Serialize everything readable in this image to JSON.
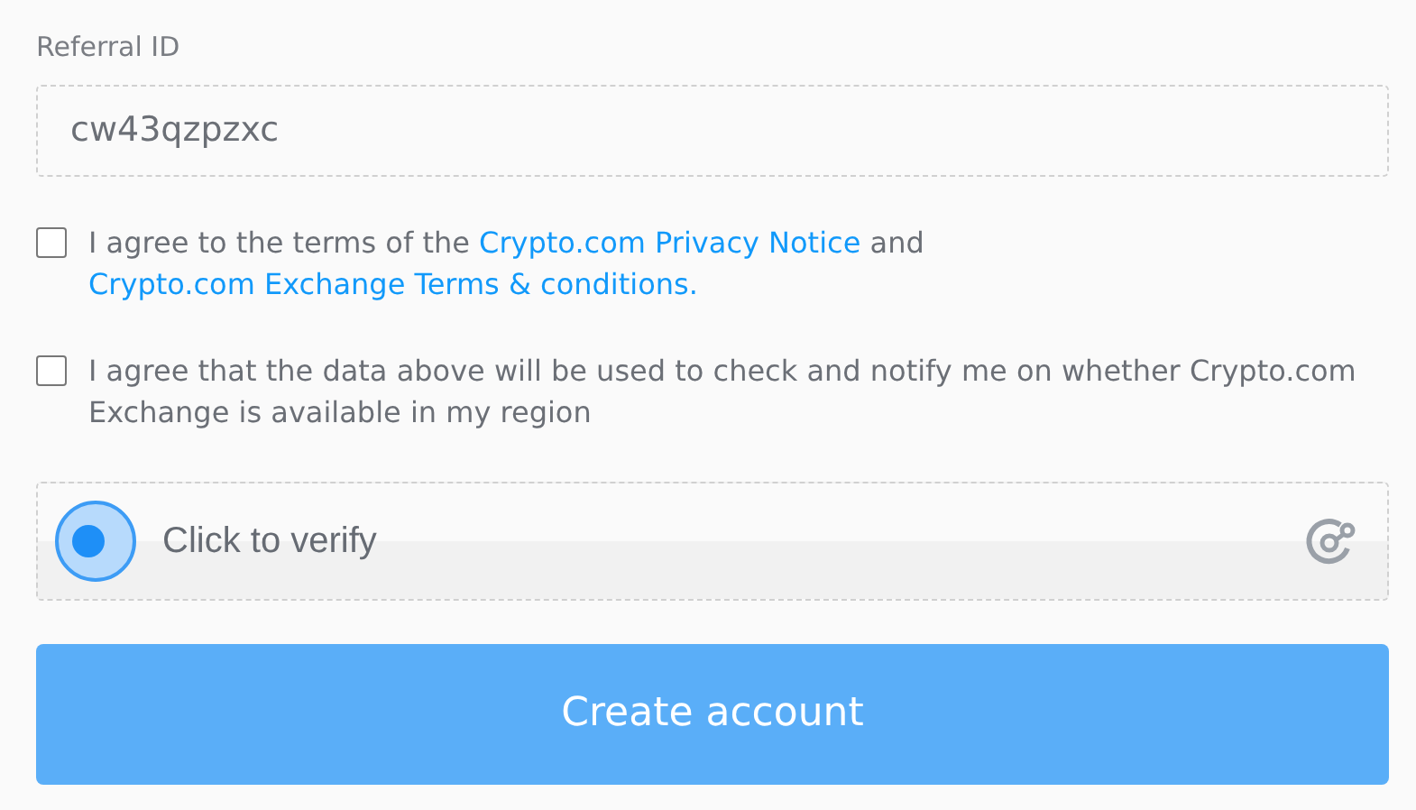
{
  "referral": {
    "label": "Referral ID",
    "value": "cw43qzpzxc"
  },
  "agreements": [
    {
      "checked": false,
      "parts": [
        {
          "kind": "text",
          "text": "I agree to the terms of the "
        },
        {
          "kind": "link",
          "text": "Crypto.com Privacy Notice"
        },
        {
          "kind": "text",
          "text": " and "
        },
        {
          "kind": "link",
          "text": "Crypto.com Exchange Terms & conditions."
        }
      ]
    },
    {
      "checked": false,
      "parts": [
        {
          "kind": "text",
          "text": "I agree that the data above will be used to check and notify me on whether Crypto.com Exchange is available in my region"
        }
      ]
    }
  ],
  "captcha": {
    "label": "Click to verify"
  },
  "submit": {
    "label": "Create account",
    "disabled": true
  }
}
